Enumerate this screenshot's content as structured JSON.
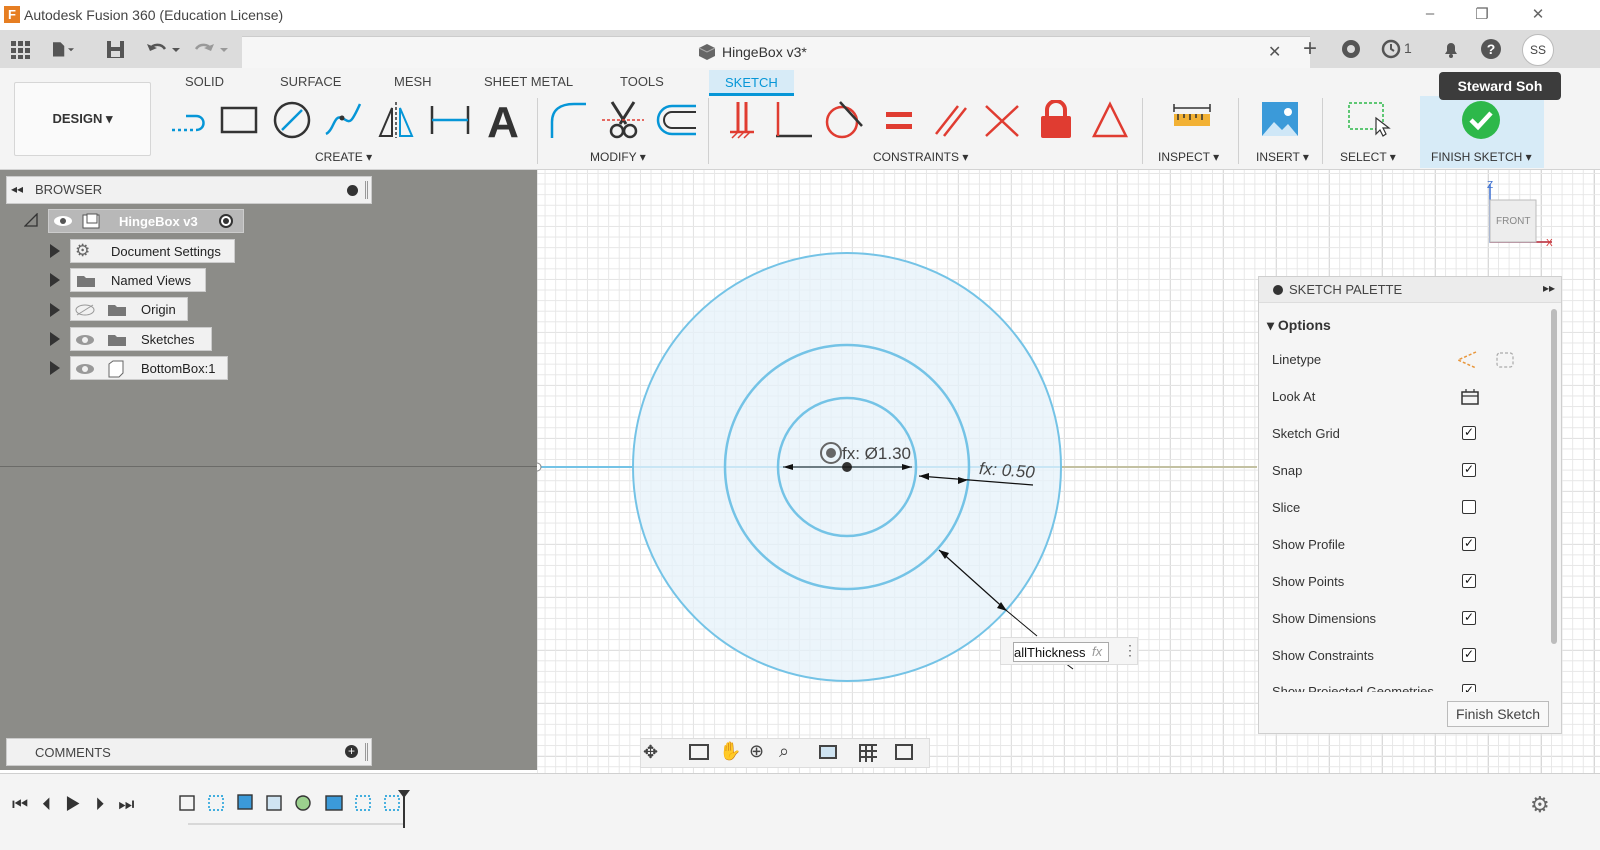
{
  "window": {
    "title": "Autodesk Fusion 360 (Education License)",
    "logo_letter": "F"
  },
  "tabbar": {
    "doc_title": "HingeBox v3*",
    "jobs_count": "1",
    "avatar_initials": "SS"
  },
  "ribbon": {
    "tabs": [
      "SOLID",
      "SURFACE",
      "MESH",
      "SHEET METAL",
      "TOOLS",
      "SKETCH"
    ],
    "active_tab": "SKETCH",
    "workspace": "DESIGN ▾",
    "groups": {
      "create": "CREATE ▾",
      "modify": "MODIFY ▾",
      "constraints": "CONSTRAINTS ▾",
      "inspect": "INSPECT ▾",
      "insert": "INSERT ▾",
      "select": "SELECT ▾",
      "finish": "FINISH SKETCH ▾"
    },
    "tooltip": "Steward Soh"
  },
  "browser": {
    "title": "BROWSER",
    "root": "HingeBox v3",
    "items": [
      "Document Settings",
      "Named Views",
      "Origin",
      "Sketches",
      "BottomBox:1"
    ]
  },
  "comments": {
    "title": "COMMENTS"
  },
  "canvas": {
    "dim_diameter": "fx: Ø1.30",
    "dim_offset": "fx: 0.50",
    "dim_input_value": "allThickness",
    "dim_input_fx": "fx",
    "viewcube_label": "FRONT",
    "axis_z": "Z",
    "axis_x": "X"
  },
  "palette": {
    "title": "SKETCH PALETTE",
    "section": "Options",
    "options": [
      {
        "label": "Linetype",
        "type": "icons"
      },
      {
        "label": "Look At",
        "type": "icon"
      },
      {
        "label": "Sketch Grid",
        "type": "check",
        "checked": true
      },
      {
        "label": "Snap",
        "type": "check",
        "checked": true
      },
      {
        "label": "Slice",
        "type": "check",
        "checked": false
      },
      {
        "label": "Show Profile",
        "type": "check",
        "checked": true
      },
      {
        "label": "Show Points",
        "type": "check",
        "checked": true
      },
      {
        "label": "Show Dimensions",
        "type": "check",
        "checked": true
      },
      {
        "label": "Show Constraints",
        "type": "check",
        "checked": true
      },
      {
        "label": "Show Projected Geometries",
        "type": "check",
        "checked": true
      }
    ],
    "finish_button": "Finish Sketch"
  },
  "colors": {
    "accent": "#0696d7",
    "sketch": "#74c3e6",
    "finish_green": "#2db84a",
    "constraint_red": "#e03c31"
  }
}
